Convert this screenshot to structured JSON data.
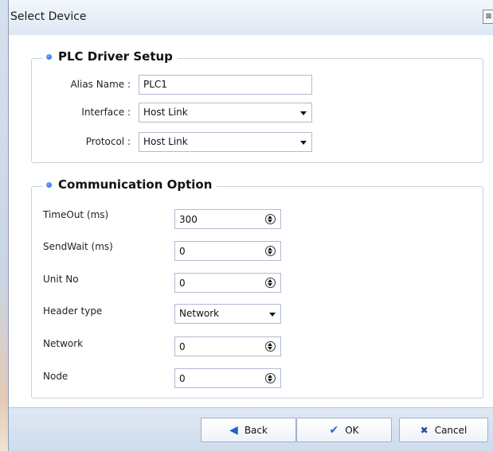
{
  "window": {
    "title": "Select Device",
    "close_glyph": "⊠"
  },
  "plc_driver_setup": {
    "title": "PLC Driver Setup",
    "alias_label": "Alias Name :",
    "alias_value": "PLC1",
    "interface_label": "Interface :",
    "interface_value": "Host Link",
    "protocol_label": "Protocol :",
    "protocol_value": "Host Link"
  },
  "communication_option": {
    "title": "Communication Option",
    "timeout_label": "TimeOut (ms)",
    "timeout_value": "300",
    "sendwait_label": "SendWait (ms)",
    "sendwait_value": "0",
    "unitno_label": "Unit No",
    "unitno_value": "0",
    "header_label": "Header type",
    "header_value": "Network",
    "network_label": "Network",
    "network_value": "0",
    "node_label": "Node",
    "node_value": "0"
  },
  "footer": {
    "back_label": "Back",
    "ok_label": "OK",
    "cancel_label": "Cancel"
  },
  "icons": {
    "back": "left-arrow-icon",
    "ok": "checkmark-icon",
    "cancel": "x-icon",
    "bullet": "bullet-dot-icon",
    "spin": "spinner-updown-icon",
    "dropdown": "dropdown-arrow-icon"
  },
  "colors": {
    "accent": "#1a5fcf",
    "titlebar": "#dde7f3",
    "footer": "#cfdcee",
    "group_border": "#c9d3e0"
  }
}
